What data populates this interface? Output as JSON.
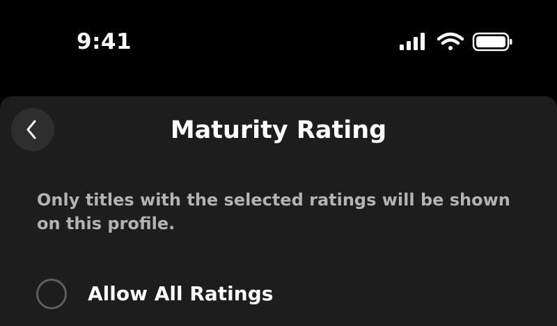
{
  "status_bar": {
    "time": "9:41",
    "icons": [
      "cellular-signal-icon",
      "wifi-icon",
      "battery-icon"
    ]
  },
  "header": {
    "back_icon": "chevron-left-icon",
    "title": "Maturity Rating"
  },
  "description": "Only titles with the selected ratings will be shown on this profile.",
  "options": [
    {
      "label": "Allow All Ratings",
      "selected": false
    }
  ],
  "colors": {
    "background": "#000000",
    "sheet": "#1d1d1d",
    "back_button": "#2e2e2e",
    "description_text": "#b3b3b3",
    "radio_border": "#5e5e5e"
  }
}
